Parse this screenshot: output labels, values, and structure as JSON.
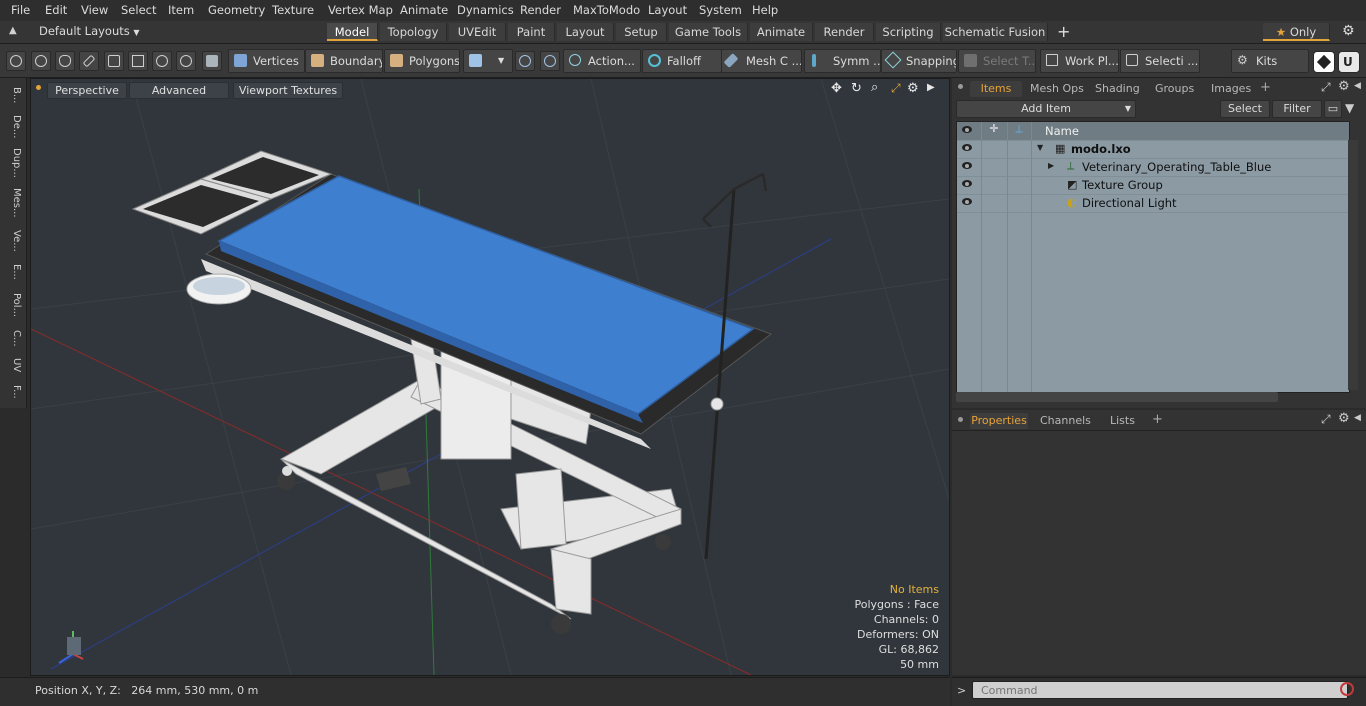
{
  "menu": [
    "File",
    "Edit",
    "View",
    "Select",
    "Item",
    "Geometry",
    "Texture",
    "Vertex Map",
    "Animate",
    "Dynamics",
    "Render",
    "MaxToModo",
    "Layout",
    "System",
    "Help"
  ],
  "layouts": {
    "label": "Default Layouts"
  },
  "tabs": [
    "Model",
    "Topology",
    "UVEdit",
    "Paint",
    "Layout",
    "Setup",
    "Game Tools",
    "Animate",
    "Render",
    "Scripting",
    "Schematic Fusion"
  ],
  "tab_add": "+",
  "only_button": "Only",
  "toolbar": {
    "vertices": "Vertices",
    "boundary": "Boundary",
    "polygons": "Polygons",
    "action": "Action",
    "falloff": "Falloff",
    "mesh_c": "Mesh C ...",
    "symm": "Symm ...",
    "snapping": "Snapping",
    "select_t": "Select T...",
    "work_pl": "Work Pl...",
    "selecti": "Selecti ...",
    "kits": "Kits"
  },
  "left_strip": [
    "B...",
    "De...",
    "Dup...",
    "Mes...",
    "Ve...",
    "E...",
    "Pol...",
    "C...",
    "UV",
    "F..."
  ],
  "viewport": {
    "perspective": "Perspective",
    "advanced": "Advanced",
    "viewport_textures": "Viewport Textures",
    "hud": {
      "items": "No Items",
      "polygons": "Polygons : Face",
      "channels": "Channels: 0",
      "deformers": "Deformers: ON",
      "gl": "GL: 68,862",
      "scale": "50 mm"
    }
  },
  "status": {
    "position": "Position X, Y, Z:   264 mm, 530 mm, 0 m"
  },
  "items_panel": {
    "tabs": [
      "Items",
      "Mesh Ops",
      "Shading",
      "Groups",
      "Images"
    ],
    "add_item": "Add Item",
    "select": "Select",
    "filter": "Filter",
    "name_header": "Name",
    "tree": [
      {
        "label": "modo.lxo",
        "bold": true
      },
      {
        "label": "Veterinary_Operating_Table_Blue"
      },
      {
        "label": "Texture Group"
      },
      {
        "label": "Directional Light"
      }
    ]
  },
  "properties_panel": {
    "tabs": [
      "Properties",
      "Channels",
      "Lists"
    ]
  },
  "command": {
    "placeholder": "Command"
  },
  "colors": {
    "accent": "#e3a33b",
    "table_top": "#3f7fd0",
    "viewport_bg": "#30363b",
    "tree_bg": "#8b9aa3"
  }
}
